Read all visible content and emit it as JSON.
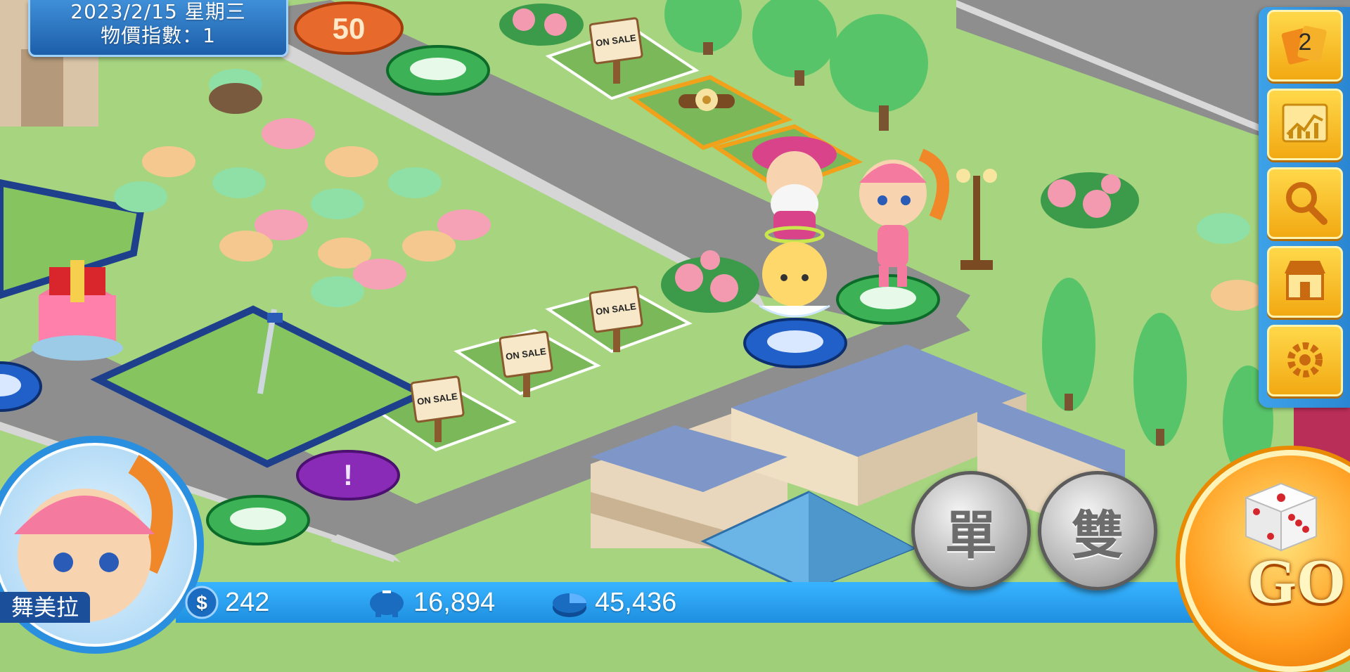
{
  "header": {
    "date": "2023/2/15 星期三",
    "price_index": "物價指數：1"
  },
  "board": {
    "sale_signs": [
      "ON SALE",
      "ON SALE",
      "ON SALE",
      "ON SALE",
      "ON SALE"
    ],
    "tile_50": "50"
  },
  "sidebar": {
    "card_count": "2",
    "items": [
      "cards-icon",
      "stock-chart-icon",
      "search-icon",
      "shop-icon",
      "settings-gear-icon"
    ]
  },
  "player": {
    "name": "舞美拉",
    "cash": "242",
    "savings": "16,894",
    "assets": "45,436"
  },
  "dice_controls": {
    "single_label": "單",
    "double_label": "雙",
    "go_label": "GO"
  },
  "colors": {
    "ui_blue": "#2a86d2",
    "button_gold": "#f2a912",
    "road_gray": "#8f8f8f",
    "grass": "#9fcf78"
  }
}
